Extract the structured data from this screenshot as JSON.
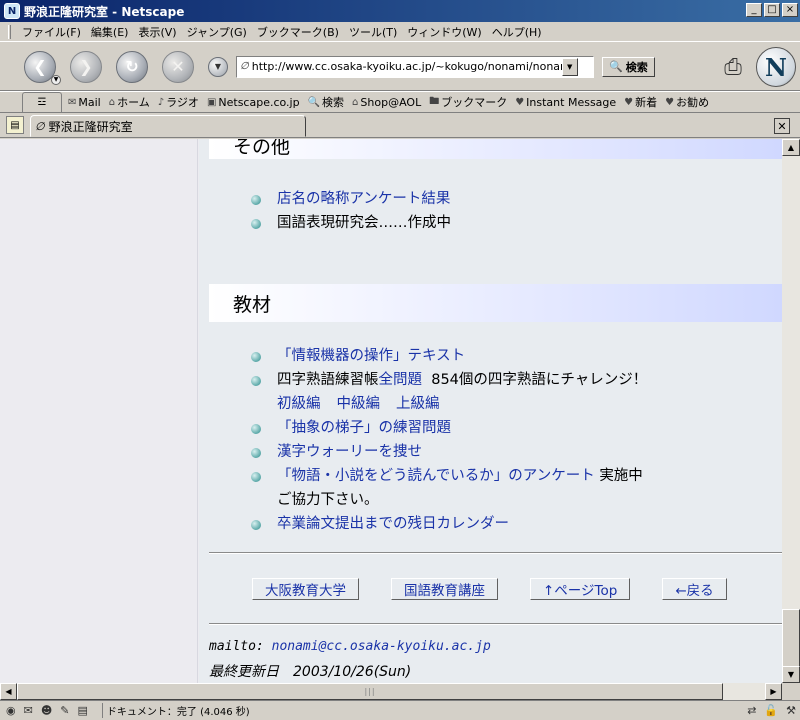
{
  "window": {
    "title": "野浪正隆研究室 - Netscape",
    "minimize": "_",
    "maximize": "□",
    "close": "×"
  },
  "menu": [
    "ファイル(F)",
    "編集(E)",
    "表示(V)",
    "ジャンプ(G)",
    "ブックマーク(B)",
    "ツール(T)",
    "ウィンドウ(W)",
    "ヘルプ(H)"
  ],
  "nav": {
    "url": "http://www.cc.osaka-kyoiku.ac.jp/~kokugo/nonami/nonamiken",
    "search_label": "検索"
  },
  "personal_toolbar": [
    {
      "icon": "mail-icon",
      "label": "Mail"
    },
    {
      "icon": "home-icon",
      "label": "ホーム"
    },
    {
      "icon": "radio-icon",
      "label": "ラジオ"
    },
    {
      "icon": "my-netscape-icon",
      "label": "Netscape.co.jp"
    },
    {
      "icon": "search-icon",
      "label": "検索"
    },
    {
      "icon": "shop-icon",
      "label": "Shop@AOL"
    },
    {
      "icon": "bookmark-folder-icon",
      "label": "ブックマーク"
    },
    {
      "icon": "bookmark-icon",
      "label": "Instant Message"
    },
    {
      "icon": "bookmark-icon",
      "label": "新着"
    },
    {
      "icon": "bookmark-icon",
      "label": "お勧め"
    }
  ],
  "tab": {
    "title": "野浪正隆研究室"
  },
  "page": {
    "section_other": {
      "title": "その他",
      "items": [
        {
          "text": "店名の略称アンケート結果",
          "link": true
        },
        {
          "text": "国語表現研究会……作成中",
          "link": false
        }
      ]
    },
    "section_materials": {
      "title": "教材",
      "item1": "「情報機器の操作」テキスト",
      "item2_plain_prefix": "四字熟語練習帳",
      "item2_link": "全問題",
      "item2_suffix": "854個の四字熟語にチャレンジ！",
      "item2_sub": [
        "初級編",
        "中級編",
        "上級編"
      ],
      "item3": "「抽象の梯子」の練習問題",
      "item4": "漢字ウォーリーを捜せ",
      "item5_link": "「物語・小説をどう読んでいるか」のアンケート",
      "item5_suffix": "実施中",
      "item5_cont": "ご協力下さい。",
      "item6": "卒業論文提出までの残日カレンダー"
    },
    "footer_nav": [
      "大阪教育大学",
      "国語教育講座",
      "↑ページTop",
      "←戻る"
    ],
    "mailto_prefix": "mailto:",
    "mailto_address": "nonami@cc.osaka-kyoiku.ac.jp",
    "last_modified": "最終更新日　2003/10/26(Sun)"
  },
  "status": {
    "text": "ドキュメント：完了 (4.046 秒)"
  }
}
